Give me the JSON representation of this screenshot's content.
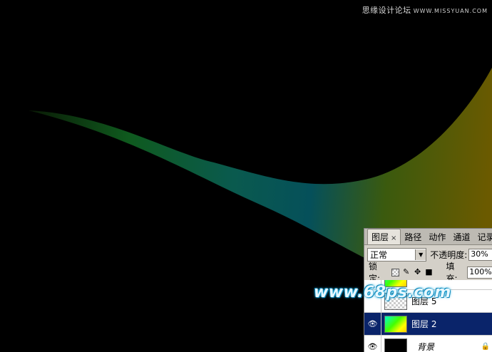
{
  "watermark_top": {
    "text": "思缘设计论坛",
    "site": "WWW.MISSYUAN.COM"
  },
  "watermark_bottom": {
    "text": "www.68ps.com"
  },
  "panel": {
    "tabs": [
      {
        "label": "图层",
        "close": "×"
      },
      {
        "label": "路径"
      },
      {
        "label": "动作"
      },
      {
        "label": "通道"
      },
      {
        "label": "记录"
      }
    ],
    "blend_mode": "正常",
    "opacity_label": "不透明度:",
    "opacity_value": "30%",
    "lock_label": "锁定:",
    "fill_label": "填充:",
    "fill_value": "100%",
    "layers": [
      {
        "name": ""
      },
      {
        "name": "图层 5"
      },
      {
        "name": "图层 2",
        "selected": true
      },
      {
        "name": "背景"
      }
    ]
  },
  "colors": {
    "selected_layer": "#0a246a",
    "panel_bg": "#d4d0c8"
  },
  "icons": [
    "eye-icon",
    "lock-transparent-icon",
    "brush-icon",
    "move-icon",
    "lock-icon",
    "dropdown-arrow-icon"
  ]
}
